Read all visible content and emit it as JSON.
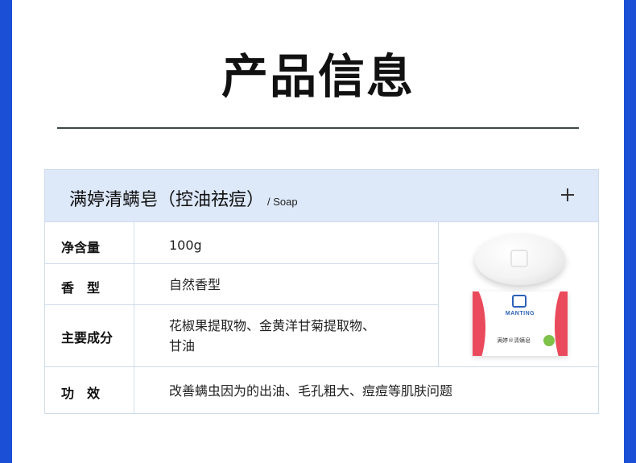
{
  "page": {
    "title": "产品信息"
  },
  "card": {
    "title": "满婷清螨皂（控油祛痘）",
    "subtitle": "/ Soap",
    "expand_icon": "plus-icon"
  },
  "specs": [
    {
      "label": "净含量",
      "value": "100g"
    },
    {
      "label": "香　型",
      "value": "自然香型"
    },
    {
      "label": "主要成分",
      "value_line1": "花椒果提取物、金黄洋甘菊提取物、",
      "value_line2": "甘油"
    },
    {
      "label": "功　效",
      "value": "改善螨虫因为的出油、毛孔粗大、痘痘等肌肤问题"
    }
  ],
  "product_image": {
    "brand": "MANTING",
    "box_name": "满婷®清螨皂"
  },
  "colors": {
    "side_bar": "#1a4fd6",
    "header_bg": "#dde8f9",
    "border": "#cfdcec",
    "accent_red": "#ea4b5c"
  }
}
